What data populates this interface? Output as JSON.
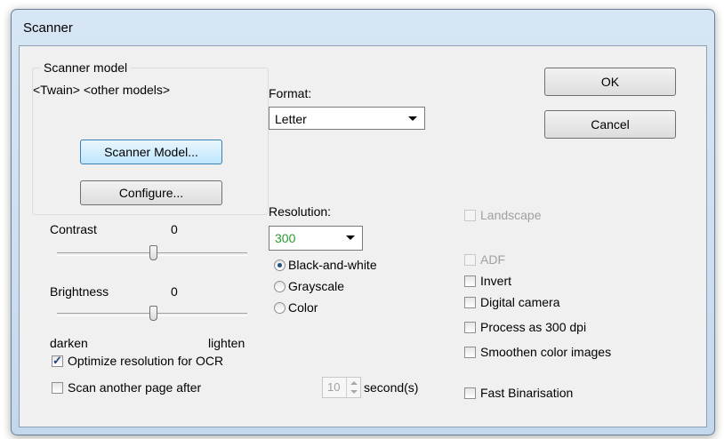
{
  "window": {
    "title": "Scanner"
  },
  "scanner_model": {
    "group_label": "Scanner model",
    "models_text": "<Twain> <other models>",
    "scanner_model_button": "Scanner Model...",
    "configure_button": "Configure..."
  },
  "format": {
    "label": "Format:",
    "value": "Letter"
  },
  "resolution": {
    "label": "Resolution:",
    "value": "300",
    "value_color": "#2a9a2a"
  },
  "buttons": {
    "ok": "OK",
    "cancel": "Cancel"
  },
  "contrast": {
    "label": "Contrast",
    "value": "0"
  },
  "brightness": {
    "label": "Brightness",
    "value": "0"
  },
  "slider_ends": {
    "left": "darken",
    "right": "lighten"
  },
  "color_mode": {
    "options": [
      "Black-and-white",
      "Grayscale",
      "Color"
    ],
    "selected": "Black-and-white"
  },
  "options": {
    "landscape": "Landscape",
    "adf": "ADF",
    "invert": "Invert",
    "digital_camera": "Digital camera",
    "process_300": "Process as 300 dpi",
    "smoothen": "Smoothen color images",
    "fast_binarisation": "Fast Binarisation",
    "optimize_ocr": "Optimize resolution for OCR",
    "scan_another": "Scan another page after"
  },
  "timer": {
    "value": "10",
    "unit": "second(s)"
  }
}
